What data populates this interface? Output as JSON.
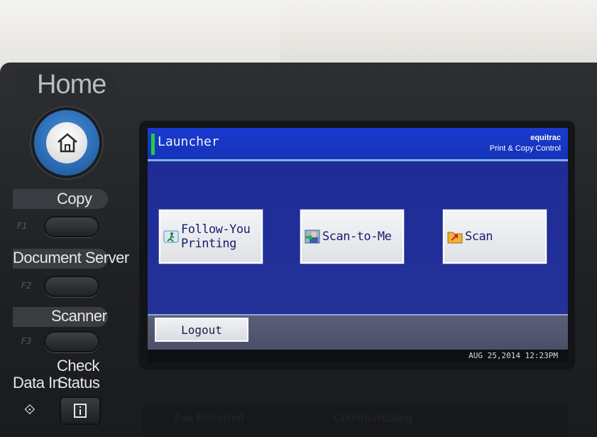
{
  "device": {
    "home_label": "Home",
    "side_buttons": [
      {
        "label": "Copy",
        "fkey": "F1"
      },
      {
        "label": "Document Server",
        "fkey": "F2"
      },
      {
        "label": "Scanner",
        "fkey": "F3"
      }
    ],
    "data_in_label": "Data In",
    "check_status_line1": "Check",
    "check_status_line2": "Status",
    "lower_texts": [
      "Fax Received",
      "Communicating"
    ]
  },
  "screen": {
    "title": "Launcher",
    "brand_name": "equitrac",
    "brand_tagline": "Print & Copy Control",
    "apps": [
      {
        "label": "Follow-You\nPrinting",
        "icon": "follow-you-icon"
      },
      {
        "label": "Scan-to-Me",
        "icon": "scan-to-me-icon"
      },
      {
        "label": "Scan",
        "icon": "scan-folder-icon"
      }
    ],
    "logout_label": "Logout",
    "datetime": "AUG  25,2014 12:23PM"
  },
  "colors": {
    "screen_bg": "#1c2a8a",
    "titlebar": "#1532b8",
    "accent_green": "#1fd13a",
    "home_button": "#2c6fb8"
  }
}
